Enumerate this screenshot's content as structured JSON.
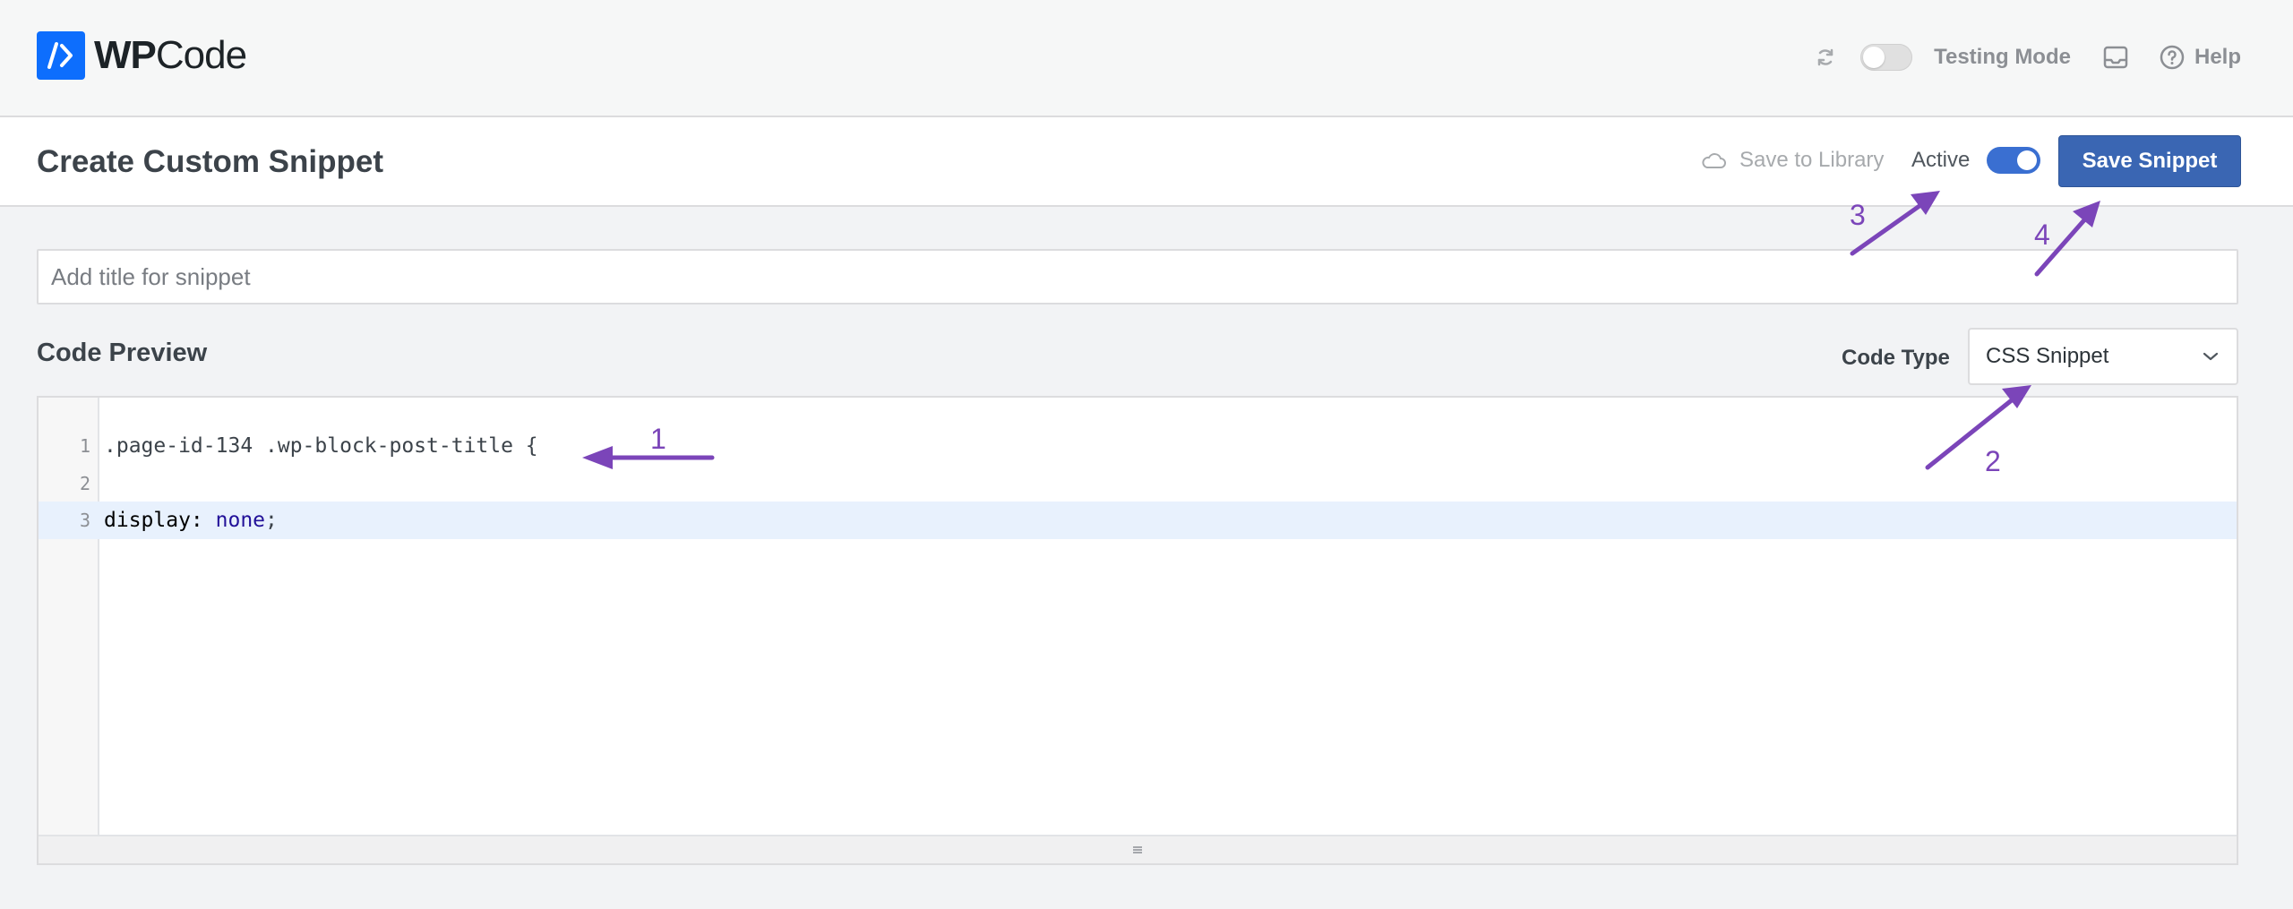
{
  "app": {
    "brand_prefix": "WP",
    "brand_suffix": "Code"
  },
  "topbar": {
    "testing_mode_label": "Testing Mode",
    "help_label": "Help",
    "icons": [
      "refresh-icon",
      "inbox-icon",
      "help-circle-icon"
    ]
  },
  "header": {
    "page_title": "Create Custom Snippet",
    "save_to_library_label": "Save to Library",
    "active_label": "Active",
    "active_on": true,
    "save_button_label": "Save Snippet"
  },
  "snippet": {
    "title_placeholder": "Add title for snippet",
    "title_value": ""
  },
  "code_preview": {
    "heading": "Code Preview",
    "code_type_label": "Code Type",
    "code_type_value": "CSS Snippet",
    "lines": [
      {
        "num": "1",
        "text": ".page-id-134 .wp-block-post-title {"
      },
      {
        "num": "2",
        "text": ""
      },
      {
        "num": "3",
        "prop": "display:",
        "value": "none",
        "end": ";"
      }
    ]
  },
  "annotations": {
    "labels": [
      "1",
      "2",
      "3",
      "4"
    ],
    "color": "#7b45b9"
  },
  "colors": {
    "brand_blue": "#0d6efd",
    "primary_button": "#3a66b3",
    "toggle_on": "#3a6fd1",
    "annotation": "#7b45b9"
  }
}
